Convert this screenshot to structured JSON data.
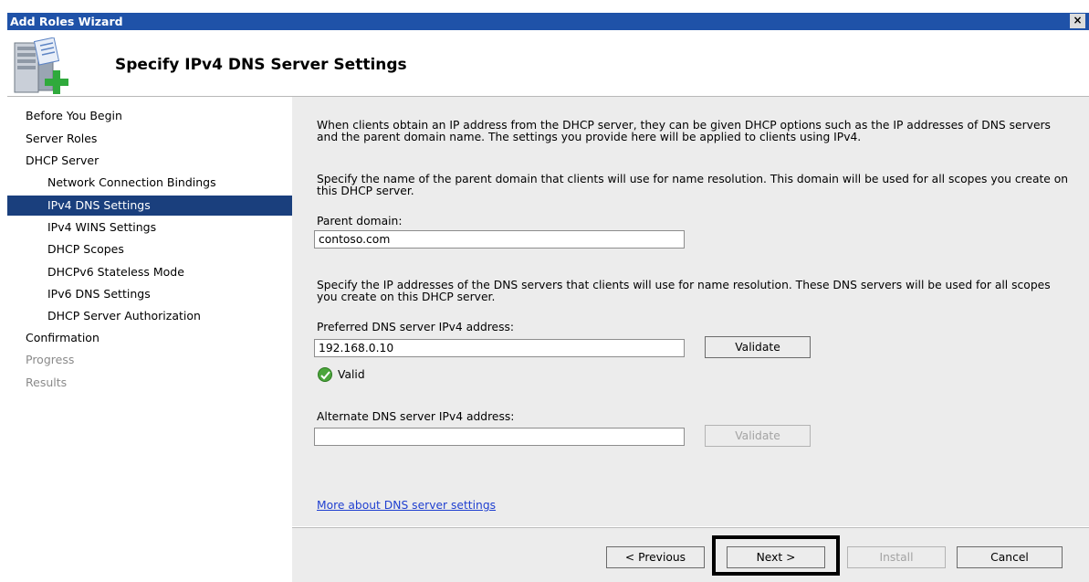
{
  "window": {
    "title": "Add Roles Wizard",
    "close_glyph": "×",
    "page_title": "Specify IPv4 DNS Server Settings",
    "wizard_icon": "server-add-icon"
  },
  "nav": {
    "items": [
      {
        "label": "Before You Begin",
        "level": "top",
        "state": "normal"
      },
      {
        "label": "Server Roles",
        "level": "top",
        "state": "normal"
      },
      {
        "label": "DHCP Server",
        "level": "top",
        "state": "normal"
      },
      {
        "label": "Network Connection Bindings",
        "level": "sub",
        "state": "normal"
      },
      {
        "label": "IPv4 DNS Settings",
        "level": "sub",
        "state": "current"
      },
      {
        "label": "IPv4 WINS Settings",
        "level": "sub",
        "state": "normal"
      },
      {
        "label": "DHCP Scopes",
        "level": "sub",
        "state": "normal"
      },
      {
        "label": "DHCPv6 Stateless Mode",
        "level": "sub",
        "state": "normal"
      },
      {
        "label": "IPv6 DNS Settings",
        "level": "sub",
        "state": "normal"
      },
      {
        "label": "DHCP Server Authorization",
        "level": "sub",
        "state": "normal"
      },
      {
        "label": "Confirmation",
        "level": "top",
        "state": "normal"
      },
      {
        "label": "Progress",
        "level": "top",
        "state": "disabled"
      },
      {
        "label": "Results",
        "level": "top",
        "state": "disabled"
      }
    ]
  },
  "content": {
    "intro": "When clients obtain an IP address from the DHCP server, they can be given DHCP options such as the IP addresses of DNS servers and the parent domain name. The settings you provide here will be applied to clients using IPv4.",
    "domain_hint": "Specify the name of the parent domain that clients will use for name resolution. This domain will be used for all scopes you create on this DHCP server.",
    "parent_domain_label": "Parent domain:",
    "parent_domain_value": "contoso.com",
    "dns_hint": "Specify the IP addresses of the DNS servers that clients will use for name resolution. These DNS servers will be used for all scopes you create on this DHCP server.",
    "preferred_label": "Preferred DNS server IPv4 address:",
    "preferred_value": "192.168.0.10",
    "validate_label": "Validate",
    "valid_text": "Valid",
    "alternate_label": "Alternate DNS server IPv4 address:",
    "alternate_value": "",
    "validate_disabled_label": "Validate",
    "more_link": "More about DNS server settings"
  },
  "footer": {
    "previous": "< Previous",
    "next": "Next >",
    "install": "Install",
    "cancel": "Cancel"
  }
}
